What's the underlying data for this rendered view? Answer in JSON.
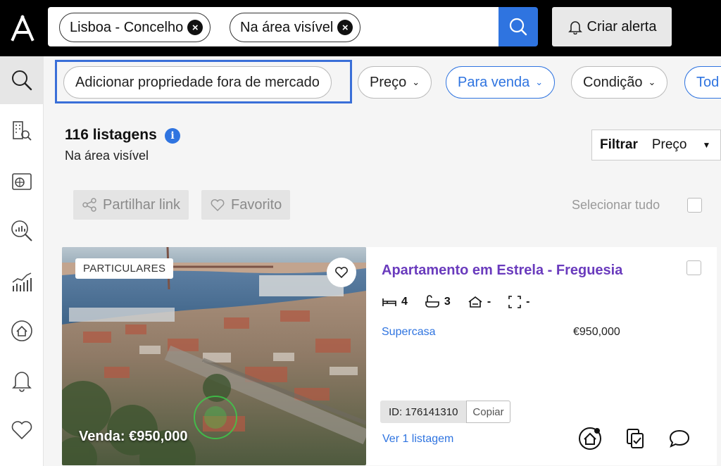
{
  "search": {
    "chips": [
      "Lisboa - Concelho",
      "Na área visível"
    ]
  },
  "header": {
    "alert_label": "Criar alerta"
  },
  "filters": {
    "add_offmarket": "Adicionar propriedade fora de mercado",
    "price": "Preço",
    "for_sale": "Para venda",
    "condition": "Condição",
    "all": "Tod"
  },
  "results": {
    "count": "116 listagens",
    "info_glyph": "i",
    "subtitle": "Na área visível",
    "sort_label": "Filtrar",
    "sort_value": "Preço",
    "share_label": "Partilhar link",
    "favorite_label": "Favorito",
    "select_all": "Selecionar tudo"
  },
  "listing": {
    "badge": "PARTICULARES",
    "price_overlay": "Venda: €950,000",
    "title": "Apartamento em Estrela - Freguesia",
    "beds": "4",
    "baths": "3",
    "parking": "-",
    "area": "-",
    "agency": "Supercasa",
    "price": "€950,000",
    "id_label": "ID: 176141310",
    "copy_label": "Copiar",
    "view_link": "Ver 1 listagem"
  },
  "colors": {
    "accent": "#2f74e0",
    "title_purple": "#6a3bbd",
    "topbar": "#000000"
  }
}
